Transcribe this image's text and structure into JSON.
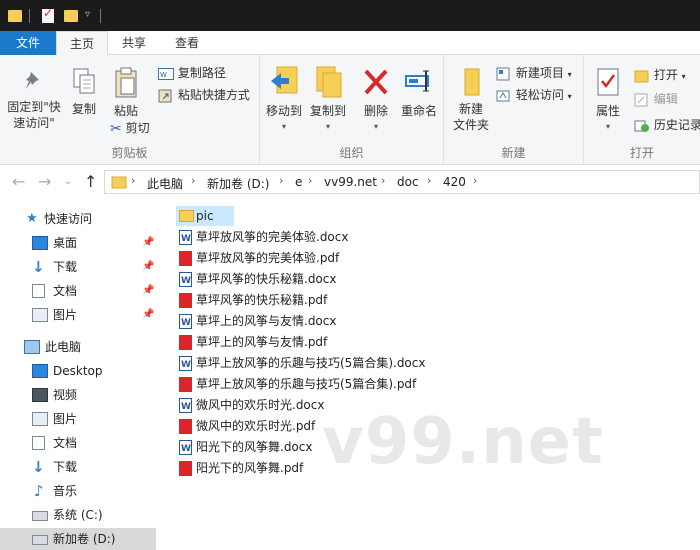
{
  "tabs": {
    "file": "文件",
    "home": "主页",
    "share": "共享",
    "view": "查看"
  },
  "ribbon": {
    "clipboard": {
      "label": "剪贴板",
      "pin_line1": "固定到\"快",
      "pin_line2": "速访问\"",
      "copy": "复制",
      "paste": "粘贴",
      "copy_path": "复制路径",
      "paste_shortcut": "粘贴快捷方式",
      "cut": "剪切"
    },
    "organize": {
      "label": "组织",
      "move_to": "移动到",
      "copy_to": "复制到",
      "delete": "删除",
      "rename": "重命名"
    },
    "new": {
      "label": "新建",
      "new_folder_line1": "新建",
      "new_folder_line2": "文件夹",
      "new_item": "新建项目",
      "easy_access": "轻松访问"
    },
    "open": {
      "label": "打开",
      "properties": "属性",
      "open": "打开",
      "edit": "编辑",
      "history": "历史记录"
    }
  },
  "address": {
    "crumbs": [
      "此电脑",
      "新加卷 (D:)",
      "e",
      "vv99.net",
      "doc",
      "420"
    ]
  },
  "nav": {
    "quick_access": "快速访问",
    "desktop_cn": "桌面",
    "downloads": "下载",
    "documents": "文档",
    "pictures": "图片",
    "this_pc": "此电脑",
    "desktop": "Desktop",
    "videos": "视频",
    "pictures2": "图片",
    "documents2": "文档",
    "downloads2": "下载",
    "music": "音乐",
    "system_c": "系统 (C:)",
    "new_vol_d": "新加卷 (D:)"
  },
  "files": [
    {
      "name": "pic",
      "type": "folder"
    },
    {
      "name": "草坪放风筝的完美体验.docx",
      "type": "docx"
    },
    {
      "name": "草坪放风筝的完美体验.pdf",
      "type": "pdf"
    },
    {
      "name": "草坪风筝的快乐秘籍.docx",
      "type": "docx"
    },
    {
      "name": "草坪风筝的快乐秘籍.pdf",
      "type": "pdf"
    },
    {
      "name": "草坪上的风筝与友情.docx",
      "type": "docx"
    },
    {
      "name": "草坪上的风筝与友情.pdf",
      "type": "pdf"
    },
    {
      "name": "草坪上放风筝的乐趣与技巧(5篇合集).docx",
      "type": "docx"
    },
    {
      "name": "草坪上放风筝的乐趣与技巧(5篇合集).pdf",
      "type": "pdf"
    },
    {
      "name": "微风中的欢乐时光.docx",
      "type": "docx"
    },
    {
      "name": "微风中的欢乐时光.pdf",
      "type": "pdf"
    },
    {
      "name": "阳光下的风筝舞.docx",
      "type": "docx"
    },
    {
      "name": "阳光下的风筝舞.pdf",
      "type": "pdf"
    }
  ],
  "watermark": "v99.net",
  "colors": {
    "accent": "#1979ca",
    "selection": "#cce8ff",
    "folder": "#f6cf57",
    "pdf": "#d9262b",
    "word": "#2b579a"
  }
}
